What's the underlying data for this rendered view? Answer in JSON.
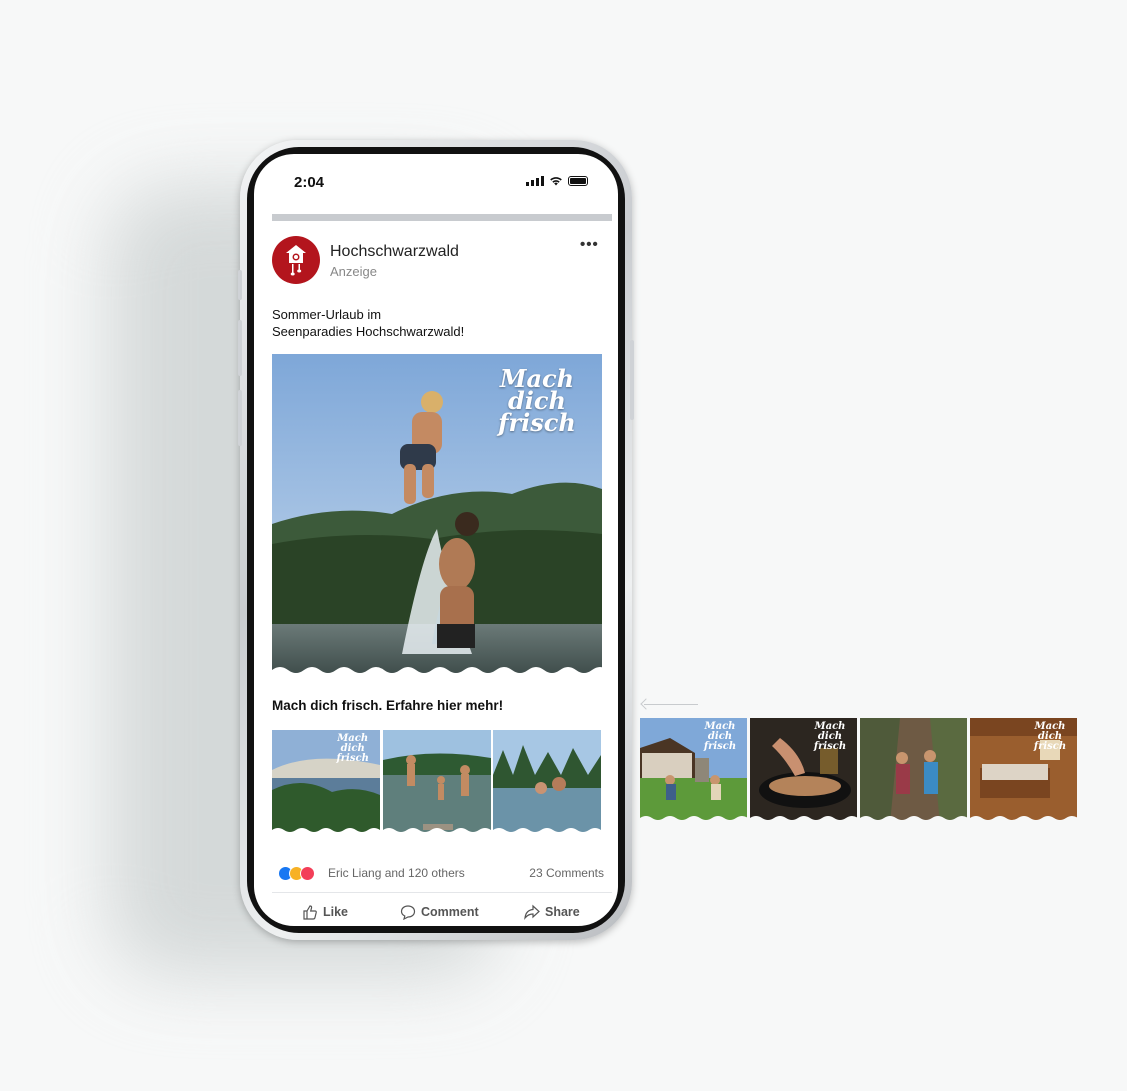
{
  "status_bar": {
    "time": "2:04"
  },
  "post": {
    "page_name": "Hochschwarzwald",
    "sponsored_label": "Anzeige",
    "text_line1": "Sommer-Urlaub im",
    "text_line2": "Seenparadies Hochschwarzwald!",
    "hero_logo": "Mach dich frisch",
    "cta_title": "Mach dich frisch. Erfahre hier mehr!",
    "reactions_text": "Eric Liang and 120 others",
    "comments_count": "23 Comments",
    "actions": {
      "like": "Like",
      "comment": "Comment",
      "share": "Share"
    }
  },
  "carousel_thumbs_in_post": [
    {
      "name": "lake-landscape",
      "logo": "Mach dich frisch"
    },
    {
      "name": "jumping-into-lake"
    },
    {
      "name": "infinity-pool"
    }
  ],
  "side_thumbs": [
    {
      "name": "farm-donkey",
      "logo": "Mach dich frisch"
    },
    {
      "name": "cooking-fish",
      "logo": "Mach dich frisch"
    },
    {
      "name": "hikers-gorge"
    },
    {
      "name": "wooden-bedroom",
      "logo": "Mach dich frisch"
    }
  ],
  "colors": {
    "brand_red": "#b3151d",
    "like_blue": "#1877f2",
    "love_red": "#f33e58",
    "wow_yellow": "#f7b125"
  }
}
